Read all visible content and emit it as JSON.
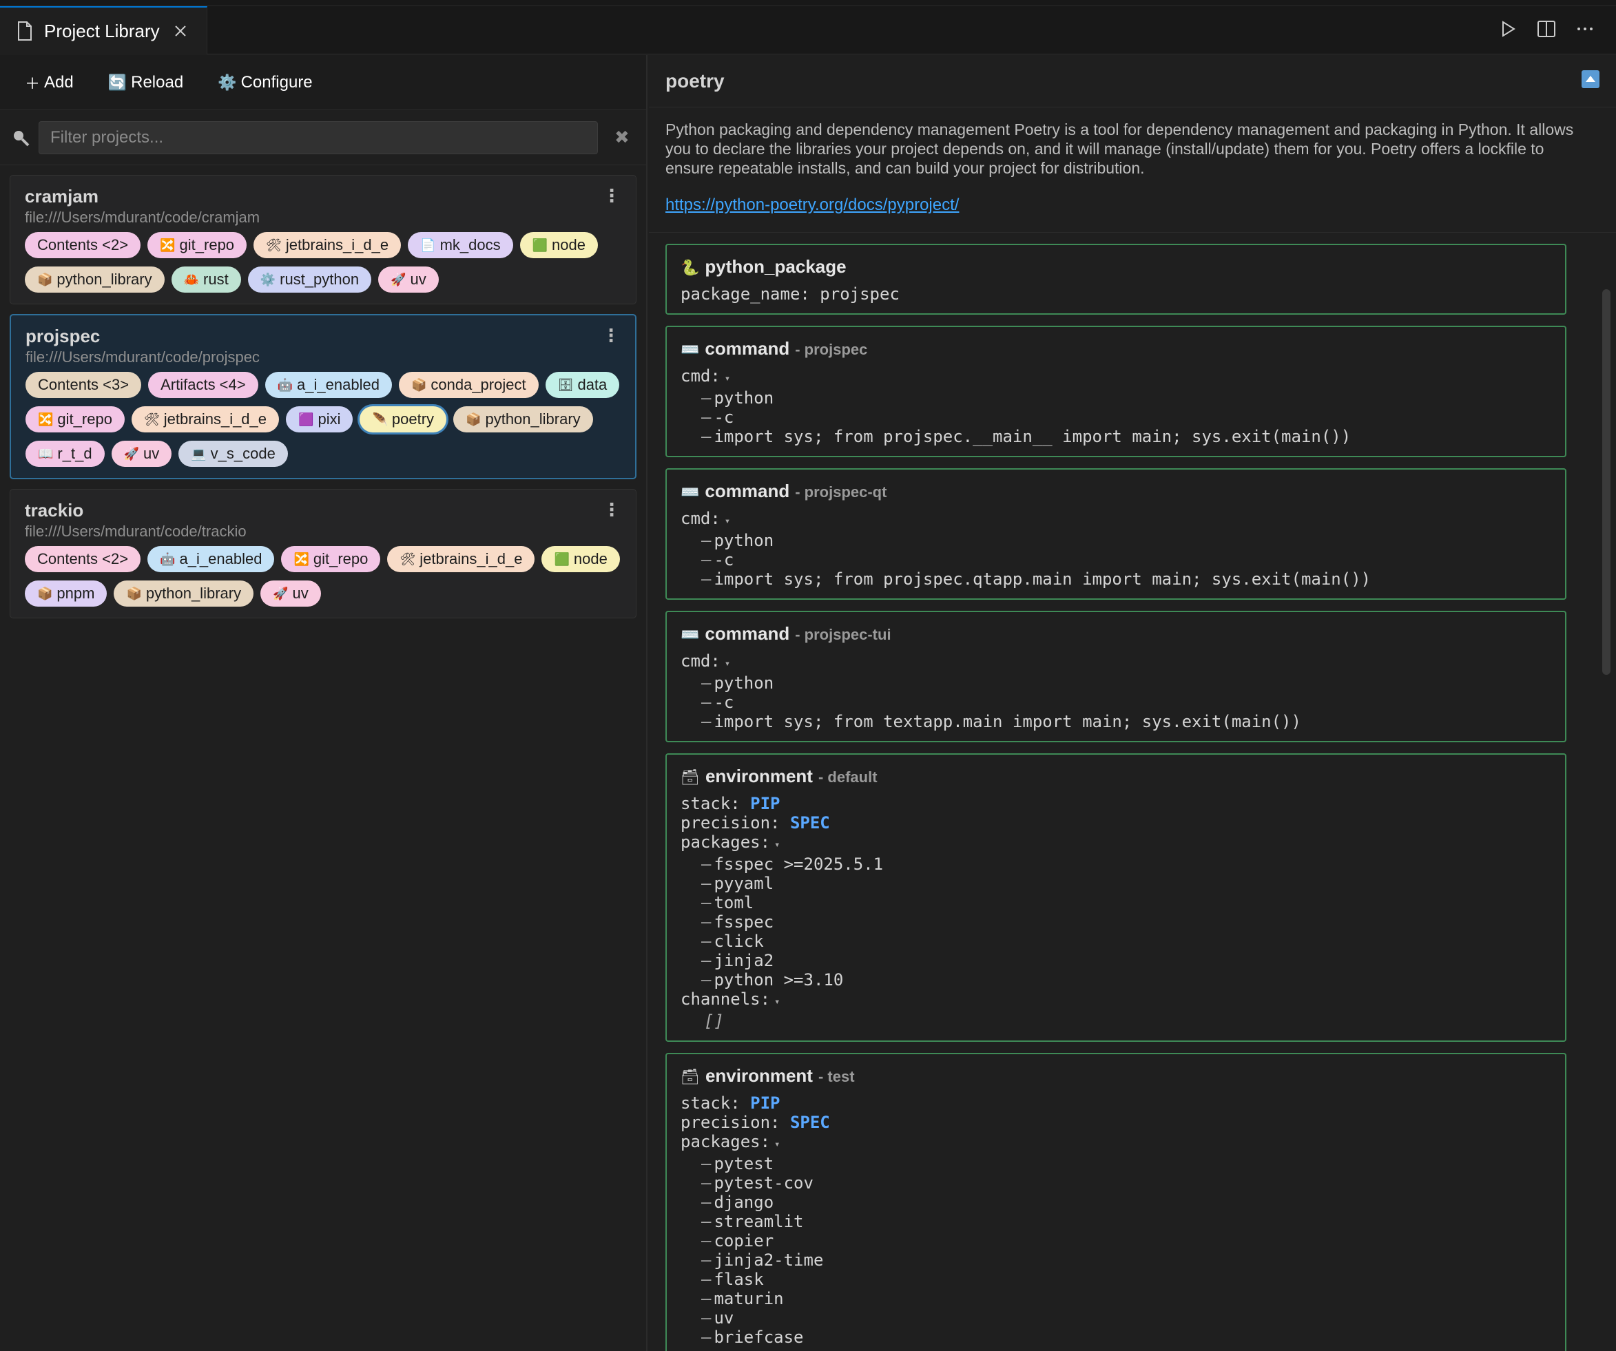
{
  "tab": {
    "title": "Project Library"
  },
  "toolbar": {
    "add": "Add",
    "reload": "Reload",
    "configure": "Configure"
  },
  "filter": {
    "placeholder": "Filter projects..."
  },
  "projects": [
    {
      "name": "cramjam",
      "path": "file:///Users/mdurant/code/cramjam",
      "selected": false,
      "tags": [
        {
          "icon": "",
          "label": "Contents <2>",
          "color": "#f3c6e6"
        },
        {
          "icon": "🔀",
          "label": "git_repo",
          "color": "#f3c6e6"
        },
        {
          "icon": "🛠",
          "label": "jetbrains_i_d_e",
          "color": "#f8dcc8"
        },
        {
          "icon": "📄",
          "label": "mk_docs",
          "color": "#ddd0f5"
        },
        {
          "icon": "🟩",
          "label": "node",
          "color": "#f7f0b8"
        },
        {
          "icon": "📦",
          "label": "python_library",
          "color": "#e6d6c0"
        },
        {
          "icon": "🦀",
          "label": "rust",
          "color": "#bfe3d3"
        },
        {
          "icon": "⚙️",
          "label": "rust_python",
          "color": "#cdd3f5"
        },
        {
          "icon": "🚀",
          "label": "uv",
          "color": "#f8cbe0"
        }
      ]
    },
    {
      "name": "projspec",
      "path": "file:///Users/mdurant/code/projspec",
      "selected": true,
      "tags": [
        {
          "icon": "",
          "label": "Contents <3>",
          "color": "#e6d6c0"
        },
        {
          "icon": "",
          "label": "Artifacts <4>",
          "color": "#f3c6e6"
        },
        {
          "icon": "🤖",
          "label": "a_i_enabled",
          "color": "#c4e2f7"
        },
        {
          "icon": "📦",
          "label": "conda_project",
          "color": "#f8dcc8"
        },
        {
          "icon": "🗄",
          "label": "data",
          "color": "#c2f0e8"
        },
        {
          "icon": "🔀",
          "label": "git_repo",
          "color": "#f3c6e6"
        },
        {
          "icon": "🛠",
          "label": "jetbrains_i_d_e",
          "color": "#f8dcc8"
        },
        {
          "icon": "🟪",
          "label": "pixi",
          "color": "#cdd3f5"
        },
        {
          "icon": "🪶",
          "label": "poetry",
          "color": "#f7f0b8",
          "active": true
        },
        {
          "icon": "📦",
          "label": "python_library",
          "color": "#e6d6c0"
        },
        {
          "icon": "📖",
          "label": "r_t_d",
          "color": "#f3c6e6"
        },
        {
          "icon": "🚀",
          "label": "uv",
          "color": "#f8cbe0"
        },
        {
          "icon": "💻",
          "label": "v_s_code",
          "color": "#cfd6e6"
        }
      ]
    },
    {
      "name": "trackio",
      "path": "file:///Users/mdurant/code/trackio",
      "selected": false,
      "tags": [
        {
          "icon": "",
          "label": "Contents <2>",
          "color": "#f8cbe0"
        },
        {
          "icon": "🤖",
          "label": "a_i_enabled",
          "color": "#c4e2f7"
        },
        {
          "icon": "🔀",
          "label": "git_repo",
          "color": "#f3c6e6"
        },
        {
          "icon": "🛠",
          "label": "jetbrains_i_d_e",
          "color": "#f8dcc8"
        },
        {
          "icon": "🟩",
          "label": "node",
          "color": "#f7f0b8"
        },
        {
          "icon": "📦",
          "label": "pnpm",
          "color": "#ddd0f5"
        },
        {
          "icon": "📦",
          "label": "python_library",
          "color": "#e6d6c0"
        },
        {
          "icon": "🚀",
          "label": "uv",
          "color": "#f8cbe0"
        }
      ]
    }
  ],
  "detail": {
    "title": "poetry",
    "description": "Python packaging and dependency management Poetry is a tool for dependency management and packaging in Python. It allows you to declare the libraries your project depends on, and it will manage (install/update) them for you. Poetry offers a lockfile to ensure repeatable installs, and can build your project for distribution.",
    "link": "https://python-poetry.org/docs/pyproject/",
    "sections": [
      {
        "icon": "🐍",
        "type": "python_package",
        "name": "",
        "lines": [
          {
            "k": "kv",
            "key": "package_name: ",
            "value": "projspec",
            "plain": true
          }
        ]
      },
      {
        "icon": "⌨️",
        "type": "command",
        "name": "- projspec",
        "lines": [
          {
            "k": "head",
            "key": "cmd:"
          },
          {
            "k": "li",
            "text": "python"
          },
          {
            "k": "li",
            "text": "-c"
          },
          {
            "k": "li",
            "text": "import sys; from projspec.__main__ import main; sys.exit(main())"
          }
        ]
      },
      {
        "icon": "⌨️",
        "type": "command",
        "name": "- projspec-qt",
        "lines": [
          {
            "k": "head",
            "key": "cmd:"
          },
          {
            "k": "li",
            "text": "python"
          },
          {
            "k": "li",
            "text": "-c"
          },
          {
            "k": "li",
            "text": "import sys; from projspec.qtapp.main import main; sys.exit(main())"
          }
        ]
      },
      {
        "icon": "⌨️",
        "type": "command",
        "name": "- projspec-tui",
        "lines": [
          {
            "k": "head",
            "key": "cmd:"
          },
          {
            "k": "li",
            "text": "python"
          },
          {
            "k": "li",
            "text": "-c"
          },
          {
            "k": "li",
            "text": "import sys; from textapp.main import main; sys.exit(main())"
          }
        ]
      },
      {
        "icon": "🗃",
        "type": "environment",
        "name": "- default",
        "lines": [
          {
            "k": "kv",
            "key": "stack: ",
            "value": "PIP"
          },
          {
            "k": "kv",
            "key": "precision: ",
            "value": "SPEC"
          },
          {
            "k": "head",
            "key": "packages:"
          },
          {
            "k": "li",
            "text": "fsspec >=2025.5.1"
          },
          {
            "k": "li",
            "text": "pyyaml"
          },
          {
            "k": "li",
            "text": "toml"
          },
          {
            "k": "li",
            "text": "fsspec"
          },
          {
            "k": "li",
            "text": "click"
          },
          {
            "k": "li",
            "text": "jinja2"
          },
          {
            "k": "li",
            "text": "python >=3.10"
          },
          {
            "k": "head",
            "key": "channels:"
          },
          {
            "k": "empty",
            "text": "[]"
          }
        ]
      },
      {
        "icon": "🗃",
        "type": "environment",
        "name": "- test",
        "lines": [
          {
            "k": "kv",
            "key": "stack: ",
            "value": "PIP"
          },
          {
            "k": "kv",
            "key": "precision: ",
            "value": "SPEC"
          },
          {
            "k": "head",
            "key": "packages:"
          },
          {
            "k": "li",
            "text": "pytest"
          },
          {
            "k": "li",
            "text": "pytest-cov"
          },
          {
            "k": "li",
            "text": "django"
          },
          {
            "k": "li",
            "text": "streamlit"
          },
          {
            "k": "li",
            "text": "copier"
          },
          {
            "k": "li",
            "text": "jinja2-time"
          },
          {
            "k": "li",
            "text": "flask"
          },
          {
            "k": "li",
            "text": "maturin"
          },
          {
            "k": "li",
            "text": "uv"
          },
          {
            "k": "li",
            "text": "briefcase"
          }
        ]
      }
    ]
  }
}
